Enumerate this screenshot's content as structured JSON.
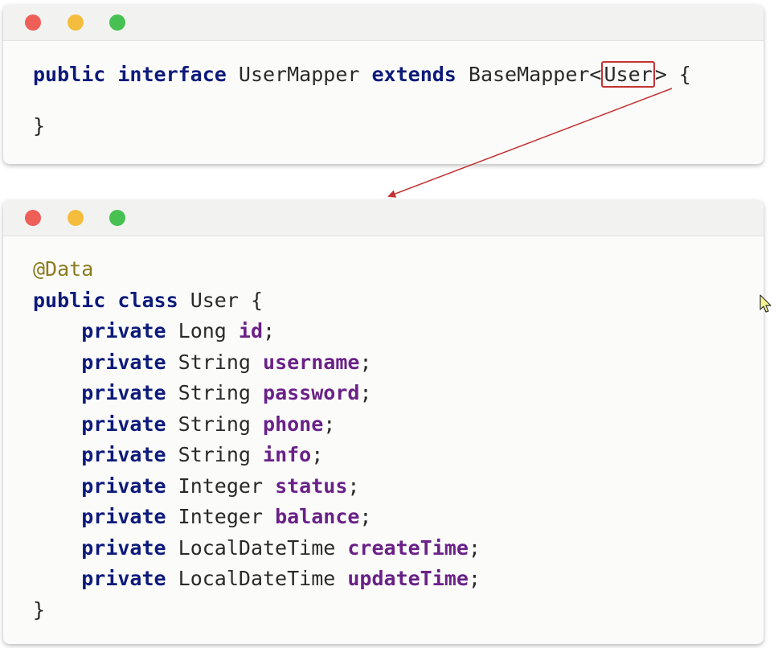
{
  "mapper_window": {
    "lines": [
      {
        "kw1": "public",
        "kw2": "interface",
        "name": "UserMapper",
        "kw3": "extends",
        "base": "BaseMapper<",
        "generic": "User",
        "close": "> {"
      },
      {
        "brace": "}"
      }
    ]
  },
  "entity_window": {
    "annotation": "@Data",
    "class_decl": {
      "kw1": "public",
      "kw2": "class",
      "name": "User",
      "open": "{"
    },
    "fields": [
      {
        "modifier": "private",
        "type": "Long",
        "name": "id",
        "end": ";"
      },
      {
        "modifier": "private",
        "type": "String",
        "name": "username",
        "end": ";"
      },
      {
        "modifier": "private",
        "type": "String",
        "name": "password",
        "end": ";"
      },
      {
        "modifier": "private",
        "type": "String",
        "name": "phone",
        "end": ";"
      },
      {
        "modifier": "private",
        "type": "String",
        "name": "info",
        "end": ";"
      },
      {
        "modifier": "private",
        "type": "Integer",
        "name": "status",
        "end": ";"
      },
      {
        "modifier": "private",
        "type": "Integer",
        "name": "balance",
        "end": ";"
      },
      {
        "modifier": "private",
        "type": "LocalDateTime",
        "name": "createTime",
        "end": ";"
      },
      {
        "modifier": "private",
        "type": "LocalDateTime",
        "name": "updateTime",
        "end": ";"
      }
    ],
    "closing_brace": "}"
  },
  "colors": {
    "keyword": "#0d1a7a",
    "field": "#6a2187",
    "annotation": "#8a7b1e",
    "highlight_box": "#c23333",
    "arrow": "#c23333"
  },
  "icons": [
    "close-dot-icon",
    "minimize-dot-icon",
    "maximize-dot-icon",
    "mouse-cursor-icon"
  ]
}
